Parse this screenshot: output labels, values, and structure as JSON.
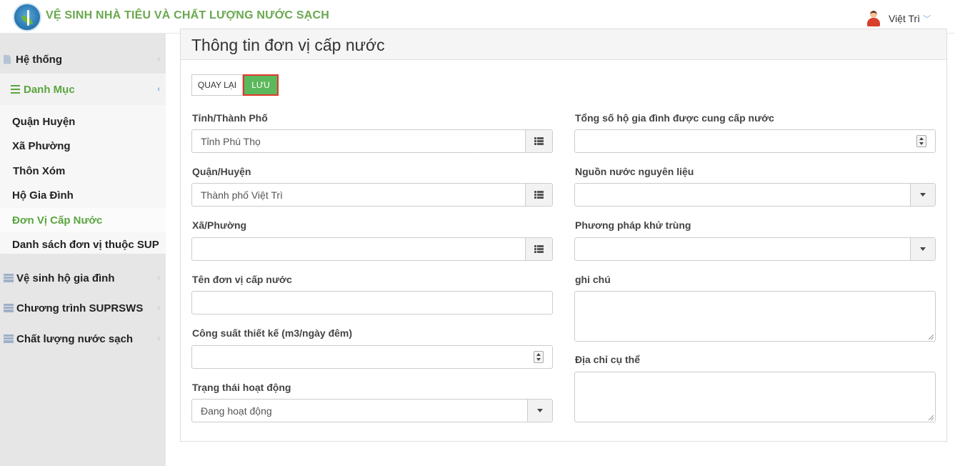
{
  "header": {
    "app_title": "VỆ SINH NHÀ TIÊU VÀ CHẤT LƯỢNG NƯỚC SẠCH",
    "user_name": "Việt Trì",
    "user_caret": "﹀"
  },
  "sidebar": {
    "chevron": "‹",
    "items": [
      {
        "label": "Hệ thống"
      },
      {
        "label": "Danh Mục"
      },
      {
        "label": "Vệ sinh hộ gia đình"
      },
      {
        "label": "Chương trình SUPRSWS"
      },
      {
        "label": "Chất lượng nước sạch"
      }
    ],
    "submenu": [
      {
        "label": "Quận Huyện"
      },
      {
        "label": "Xã Phường"
      },
      {
        "label": "Thôn Xóm"
      },
      {
        "label": "Hộ Gia Đình"
      },
      {
        "label": "Đơn Vị Cấp Nước"
      },
      {
        "label": "Danh sách đơn vị thuộc SUP"
      }
    ],
    "active_color": "#5aa53f"
  },
  "panel": {
    "title": "Thông tin đơn vị cấp nước",
    "back_label": "QUAY LẠI",
    "save_label": "LƯU"
  },
  "form": {
    "province_label": "Tỉnh/Thành Phố",
    "province_value": "Tỉnh Phú Thọ",
    "district_label": "Quận/Huyện",
    "district_value": "Thành phố Việt Trì",
    "ward_label": "Xã/Phường",
    "ward_value": "",
    "name_label": "Tên đơn vị cấp nước",
    "name_value": "",
    "capacity_label": "Công suất thiết kế (m3/ngày đêm)",
    "capacity_value": "",
    "status_label": "Trạng thái hoạt động",
    "status_value": "Đang hoạt động",
    "households_label": "Tổng số hộ gia đình được cung cấp nước",
    "households_value": "",
    "source_label": "Nguồn nước nguyên liệu",
    "source_value": "",
    "disinfection_label": "Phương pháp khử trùng",
    "disinfection_value": "",
    "note_label": "ghi chú",
    "address_label": "Địa chỉ cụ thể"
  },
  "colors": {
    "brand_green": "#6aa84f",
    "save_button": "#5cb85c",
    "save_outline": "#e2362d"
  }
}
